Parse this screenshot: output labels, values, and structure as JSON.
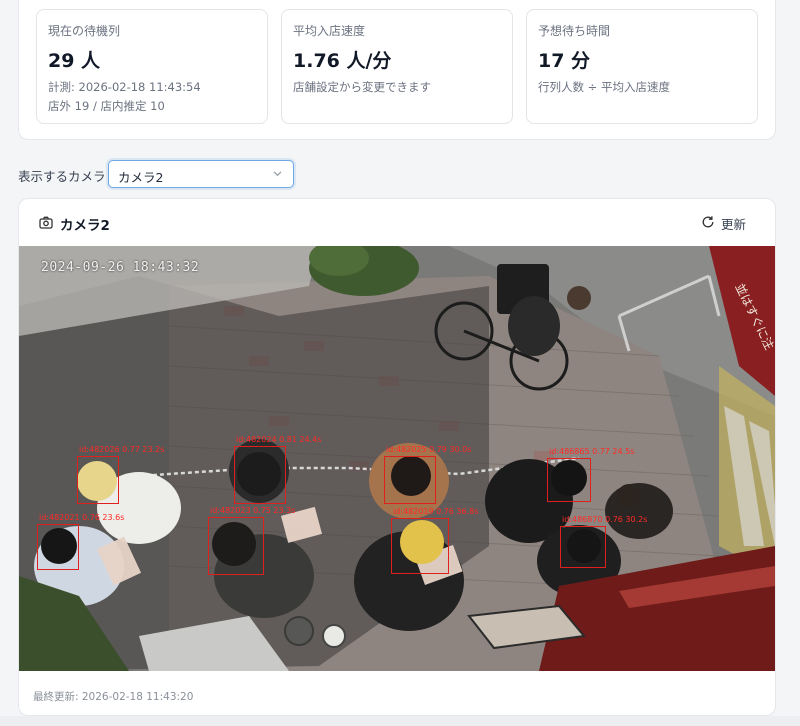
{
  "stats": [
    {
      "label": "現在の待機列",
      "value": "29 人",
      "sub1": "計測: 2026-02-18 11:43:54",
      "sub2": "店外 19 / 店内推定 10"
    },
    {
      "label": "平均入店速度",
      "value": "1.76 人/分",
      "sub1": "店舗設定から変更できます"
    },
    {
      "label": "予想待ち時間",
      "value": "17 分",
      "sub1": "行列人数 ÷ 平均入店速度"
    }
  ],
  "camera_select": {
    "label": "表示するカメラ",
    "value": "カメラ2"
  },
  "camera_card": {
    "title": "カメラ2",
    "refresh_label": "更新",
    "feed_timestamp": "2024-09-26 18:43:32",
    "detections": [
      {
        "label": "id:482026 0.77 23.2s"
      },
      {
        "label": "id:482024 0.81 24.4s"
      },
      {
        "label": "id:482025 0.79 30.0s"
      },
      {
        "label": "id:486865 0.77 24.5s"
      },
      {
        "label": "id:482021 0.76 23.6s"
      },
      {
        "label": "id:482023 0.75 23.3s"
      },
      {
        "label": "id:482019 0.76 36.8s"
      },
      {
        "label": "id:486870 0.76 30.2s"
      }
    ],
    "sign_text": "並はすぐに注",
    "last_updated": "最終更新: 2026-02-18 11:43:20"
  },
  "colors": {
    "accent": "#6ea8e6",
    "detection": "#e0201c"
  },
  "icons": {
    "camera": "camera-icon",
    "refresh": "refresh-icon",
    "chevron": "chevron-down-icon"
  }
}
